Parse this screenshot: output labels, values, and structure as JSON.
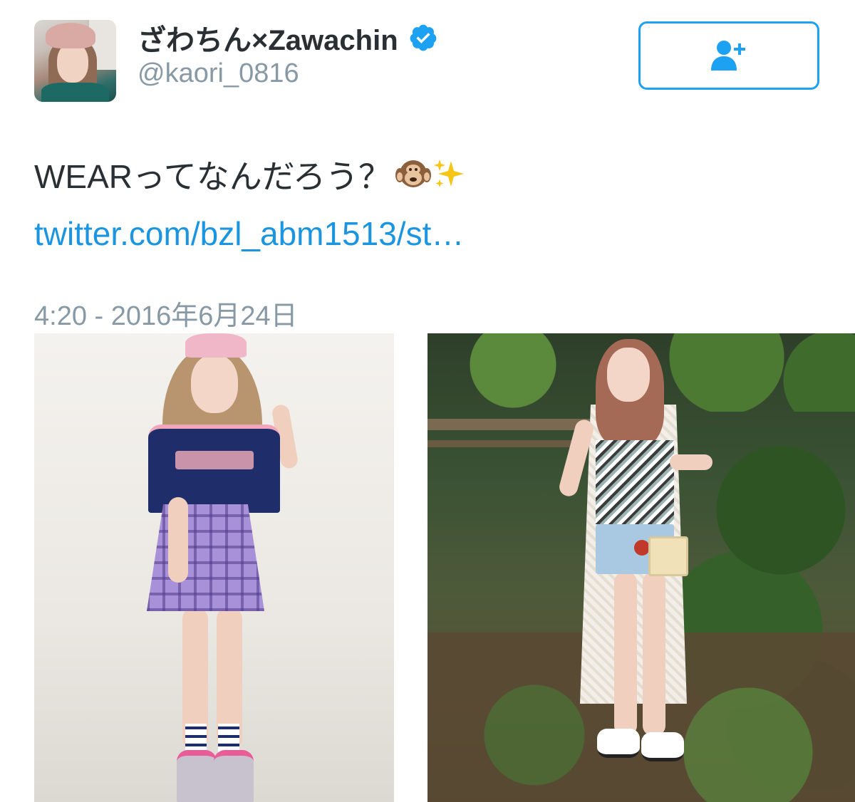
{
  "user": {
    "display_name": "ざわちん×Zawachin",
    "handle": "@kaori_0816",
    "verified_icon": "verified-badge-icon"
  },
  "follow_button": {
    "icon": "add-user-icon"
  },
  "tweet": {
    "text": "WEARってなんだろう？",
    "emojis": [
      "hear-no-evil-monkey-icon",
      "sparkles-icon"
    ],
    "link": "twitter.com/bzl_abm1513/st…",
    "timestamp": "4:20 - 2016年6月24日"
  },
  "media": {
    "photos": [
      "photo-left",
      "photo-right"
    ]
  },
  "colors": {
    "accent": "#1da1f2",
    "link": "#1b95e0",
    "name": "#292f33",
    "muted": "#8899a6"
  }
}
